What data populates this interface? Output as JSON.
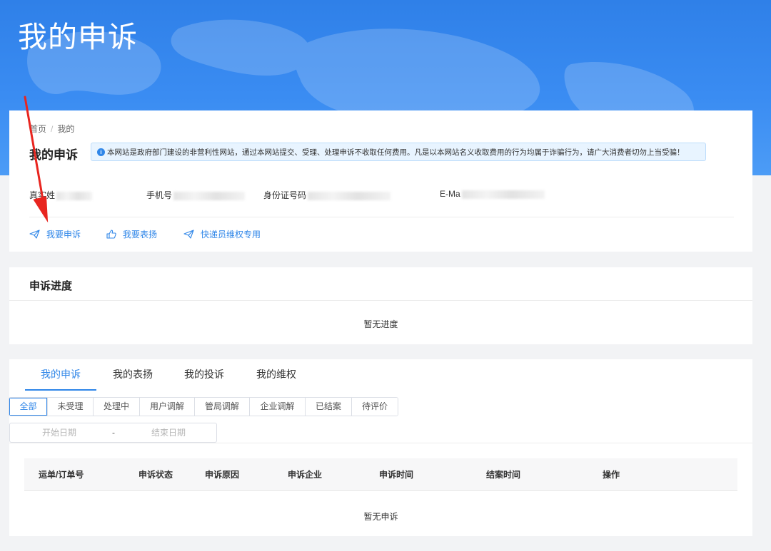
{
  "hero": {
    "title": "我的申诉"
  },
  "breadcrumb": {
    "home": "首页",
    "separator": "/",
    "current": "我的"
  },
  "page": {
    "title": "我的申诉"
  },
  "notice": {
    "text": "本网站是政府部门建设的非营利性网站，通过本网站提交、受理、处理申诉不收取任何费用。凡是以本网站名义收取费用的行为均属于诈骗行为，请广大消费者切勿上当受骗！"
  },
  "profile": {
    "name_label": "真实姓",
    "phone_label": "手机号",
    "id_label": "身份证号码",
    "email_label": "E-Ma"
  },
  "actions": {
    "complain": "我要申诉",
    "praise": "我要表扬",
    "courier": "快递员维权专用"
  },
  "progress": {
    "title": "申诉进度",
    "empty": "暂无进度"
  },
  "tabs": [
    "我的申诉",
    "我的表扬",
    "我的投诉",
    "我的维权"
  ],
  "filters": [
    "全部",
    "未受理",
    "处理中",
    "用户调解",
    "管局调解",
    "企业调解",
    "已结案",
    "待评价"
  ],
  "date_range": {
    "start_placeholder": "开始日期",
    "separator": "-",
    "end_placeholder": "结束日期"
  },
  "table": {
    "columns": [
      "运单/订单号",
      "申诉状态",
      "申诉原因",
      "申诉企业",
      "申诉时间",
      "结案时间",
      "操作"
    ],
    "empty": "暂无申诉"
  },
  "colors": {
    "accent": "#2f86e8",
    "hero": "#3a8cf2",
    "annotation": "#e8251f"
  }
}
